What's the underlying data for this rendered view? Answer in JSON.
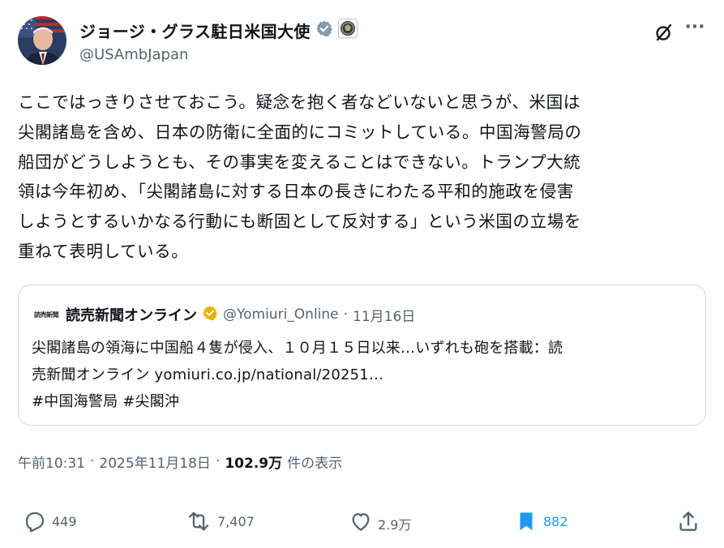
{
  "user": {
    "display_name": "ジョージ・グラス駐日米国大使",
    "handle": "@USAmbJapan",
    "verified_badge_icon": "verified-badge-icon",
    "affiliate_icon": "embassy-seal-icon"
  },
  "tweet": {
    "text_lines": [
      "ここではっきりさせておこう。疑念を抱く者などいないと思うが、米国は",
      "尖閣諸島を含め、日本の防衛に全面的にコミットしている。中国海警局の",
      "船団がどうしようとも、その事実を変えることはできない。トランプ大統",
      "領は今年初め、「尖閣諸島に対する日本の長きにわたる平和的施政を侵害",
      "しようとするいかなる行動にも断固として反対する」という米国の立場を",
      "重ねて表明している。"
    ]
  },
  "quote": {
    "logo_text": "読売新聞",
    "name": "読売新聞オンライン",
    "handle": "@Yomiuri_Online",
    "separator": "·",
    "date": "11月16日",
    "text_lines": [
      "尖閣諸島の領海に中国船４隻が侵入、１０月１５日以来…いずれも砲を搭載：読",
      "売新聞オンライン yomiuri.co.jp/national/20251…",
      "#中国海警局 #尖閣沖"
    ]
  },
  "meta": {
    "time": "午前10:31",
    "separator": "·",
    "date": "2025年11月18日",
    "views_count": "102.9万",
    "views_label": "件の表示"
  },
  "actions": {
    "replies": "449",
    "reposts": "7,407",
    "likes": "2.9万",
    "bookmarks": "882"
  },
  "colors": {
    "text": "#0f1419",
    "secondary": "#536471",
    "verified_blue": "#1d9bf0",
    "gold_badge": "#e8b400",
    "border": "#cfd9de"
  }
}
